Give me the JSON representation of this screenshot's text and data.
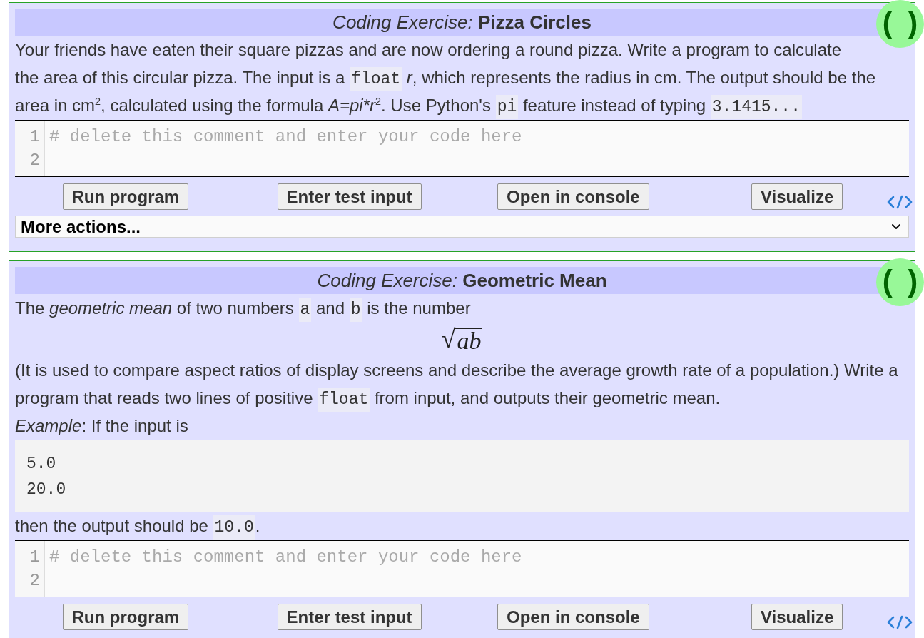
{
  "exercises": [
    {
      "title": {
        "label": "Coding Exercise:",
        "name": "Pizza Circles"
      },
      "status_badge": "( )",
      "body": [
        {
          "kind": "paragraph",
          "segments": [
            {
              "kind": "text",
              "text": "Your friends have eaten their square pizzas and are now ordering a round pizza. Write a program to calculate the area of this circular pizza. The input is a "
            },
            {
              "kind": "code",
              "text": "float"
            },
            {
              "kind": "text",
              "text": " *r*, which represents the radius in cm. The output should be the area in cm$^{2}$, calculated using the formula "
            },
            {
              "kind": "math",
              "text": "A=pi*r"
            },
            {
              "kind": "text",
              "text": "$^{2}$. Use Python's "
            },
            {
              "kind": "code",
              "text": "pi"
            },
            {
              "kind": "text",
              "text": " feature instead of typing "
            },
            {
              "kind": "code",
              "text": "3.1415..."
            }
          ]
        }
      ],
      "editor": {
        "lines": [
          {
            "number": "1",
            "code": "# delete this comment and enter your code here"
          },
          {
            "number": "2"
          }
        ]
      },
      "buttons": [
        "Run program",
        "Enter test input",
        "Open in console",
        "Visualize"
      ],
      "actions_dropdown": {
        "label": "More actions..."
      }
    },
    {
      "title": {
        "label": "Coding Exercise:",
        "name": "Geometric Mean"
      },
      "status_badge": "( )",
      "body": [
        {
          "kind": "paragraph",
          "segments": [
            {
              "kind": "text",
              "text": "The *geometric mean* of two numbers "
            },
            {
              "kind": "code",
              "text": "a"
            },
            {
              "kind": "text",
              "text": " and "
            },
            {
              "kind": "code",
              "text": "b"
            },
            {
              "kind": "text",
              "text": " is the number"
            }
          ]
        },
        {
          "kind": "formula",
          "sign": "√",
          "radicand": "ab"
        },
        {
          "kind": "paragraph",
          "segments": [
            {
              "kind": "text",
              "text": "(It is used to compare aspect ratios of display screens and describe the average growth rate of a population.) Write a program that reads two lines of positive "
            },
            {
              "kind": "code",
              "text": "float"
            },
            {
              "kind": "text",
              "text": " from input, and outputs their geometric mean."
            }
          ]
        },
        {
          "kind": "paragraph",
          "segments": [
            {
              "kind": "text",
              "text": "*Example*: If the input is"
            }
          ]
        },
        {
          "kind": "code_block",
          "lines": [
            "5.0",
            "20.0"
          ]
        },
        {
          "kind": "paragraph",
          "segments": [
            {
              "kind": "text",
              "text": "then the output should be "
            },
            {
              "kind": "code",
              "text": "10.0"
            },
            {
              "kind": "text",
              "text": "."
            }
          ]
        }
      ],
      "editor": {
        "lines": [
          {
            "number": "1",
            "code": "# delete this comment and enter your code here"
          },
          {
            "number": "2"
          }
        ]
      },
      "buttons": [
        "Run program",
        "Enter test input",
        "Open in console",
        "Visualize"
      ]
    }
  ]
}
